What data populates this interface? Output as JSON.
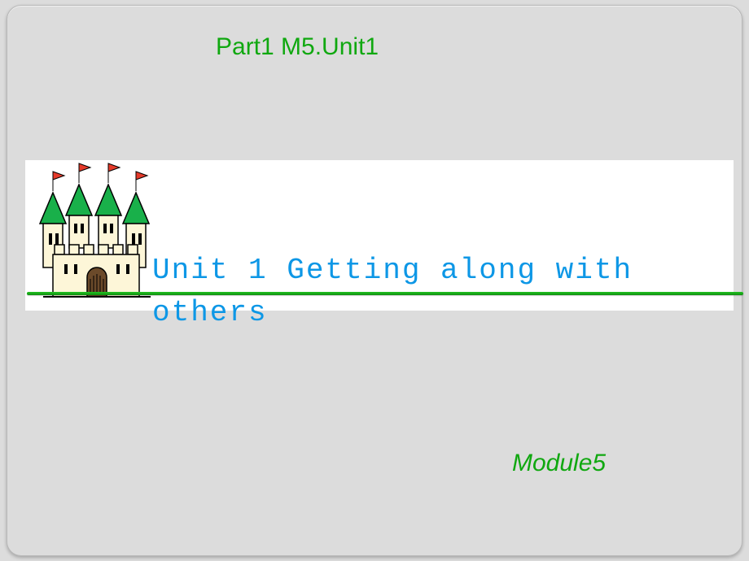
{
  "header": {
    "part_title": "Part1 M5.Unit1"
  },
  "main": {
    "unit_title": "Unit 1  Getting along with others"
  },
  "footer": {
    "module_label": "Module5"
  }
}
